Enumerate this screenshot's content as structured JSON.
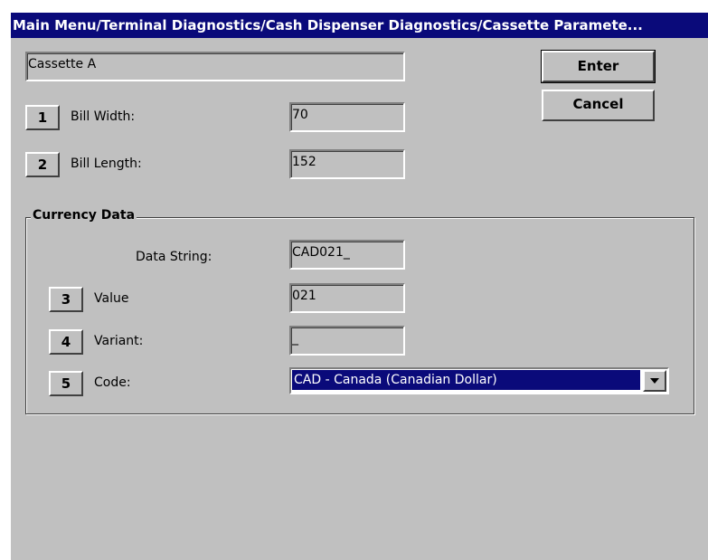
{
  "window": {
    "title": "Main Menu/Terminal Diagnostics/Cash Dispenser Diagnostics/Cassette Paramete..."
  },
  "cassette": {
    "name": "Cassette A"
  },
  "buttons": {
    "enter_label": "Enter",
    "cancel_label": "Cancel"
  },
  "bill": {
    "width": {
      "number": "1",
      "label": "Bill Width:",
      "value": "70"
    },
    "length": {
      "number": "2",
      "label": "Bill Length:",
      "value": "152"
    }
  },
  "currency": {
    "group_label": "Currency Data",
    "data_string": {
      "label": "Data String:",
      "value": "CAD021_"
    },
    "value": {
      "number": "3",
      "label": "Value",
      "value": "021"
    },
    "variant": {
      "number": "4",
      "label": "Variant:",
      "value": "_"
    },
    "code": {
      "number": "5",
      "label": "Code:",
      "selected": "CAD - Canada (Canadian Dollar)"
    }
  },
  "icons": {
    "dropdown": "chevron-down-icon"
  },
  "colors": {
    "titlebar": "#0a0a7a",
    "window_bg": "#c0c0c0",
    "selection": "#0a0a7a"
  }
}
